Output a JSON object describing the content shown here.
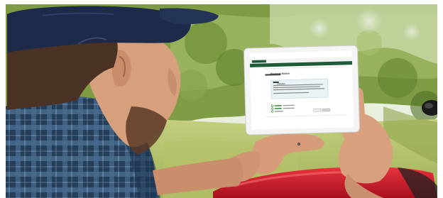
{
  "photo": {
    "description_icon": "man-holding-tablet-photo"
  },
  "tablet_screen": {
    "site_name": "",
    "sign_in": "",
    "page_title": "Payment Notice",
    "message_title": "Attention",
    "option_1": "",
    "option_2": "",
    "option_3": "",
    "button_1": "",
    "button_2": ""
  },
  "colors": {
    "header_green": "#1f5b3a",
    "sky": "#eef3e8",
    "orchard_green": "#6f8f3a",
    "grass": "#b7c46a",
    "tractor_red": "#d0162a",
    "cap_navy": "#1d2a4a",
    "shirt_blue": "#2f4e6e",
    "skin": "#d9a27f"
  }
}
